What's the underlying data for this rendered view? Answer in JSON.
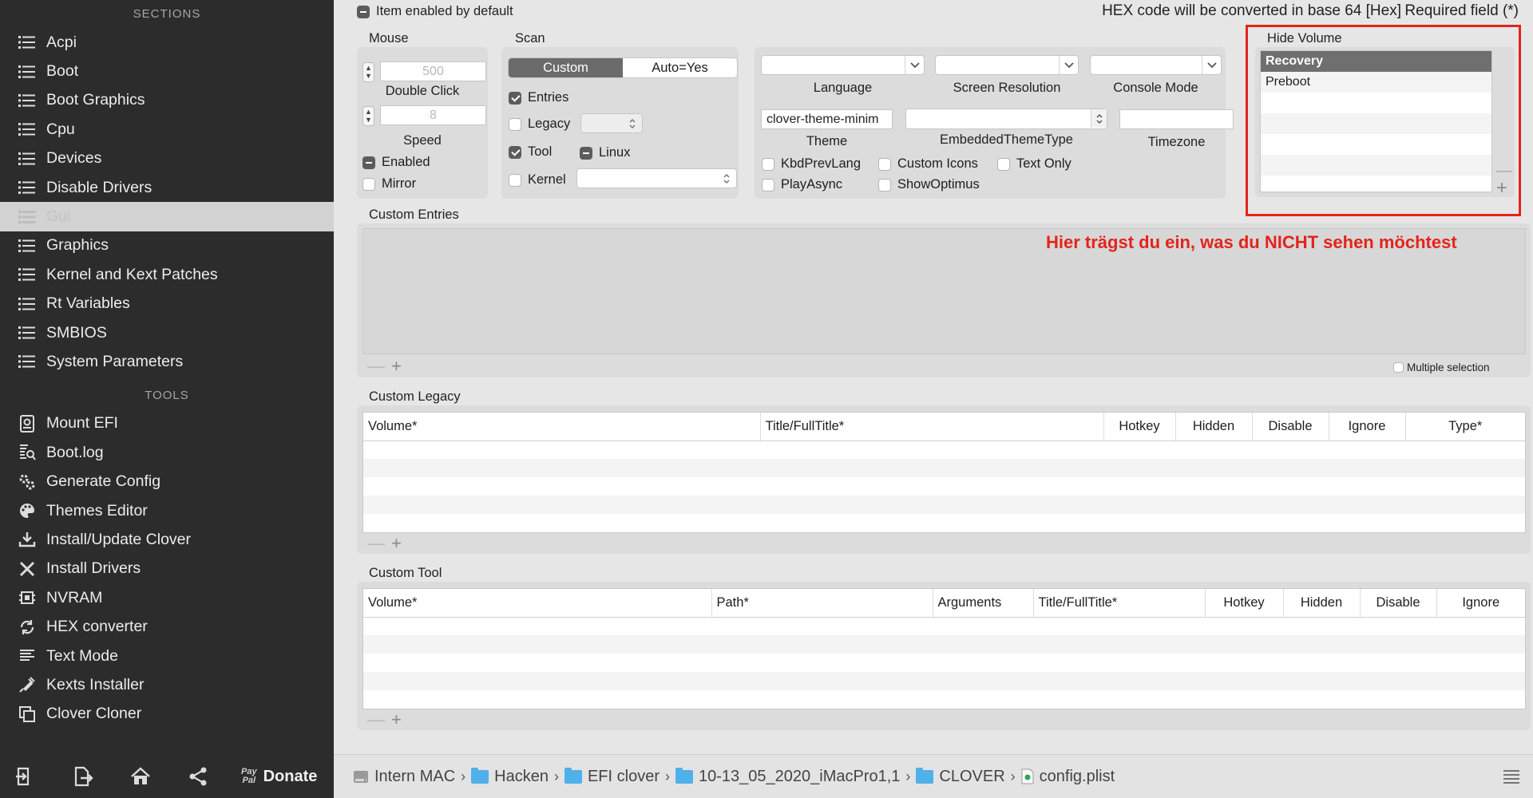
{
  "sidebar": {
    "sections_heading": "SECTIONS",
    "sections": [
      {
        "label": "Acpi"
      },
      {
        "label": "Boot"
      },
      {
        "label": "Boot Graphics"
      },
      {
        "label": "Cpu"
      },
      {
        "label": "Devices"
      },
      {
        "label": "Disable Drivers"
      },
      {
        "label": "Gui",
        "selected": true
      },
      {
        "label": "Graphics"
      },
      {
        "label": "Kernel and Kext Patches"
      },
      {
        "label": "Rt Variables"
      },
      {
        "label": "SMBIOS"
      },
      {
        "label": "System Parameters"
      }
    ],
    "tools_heading": "TOOLS",
    "tools": [
      {
        "label": "Mount EFI",
        "icon": "disk-icon"
      },
      {
        "label": "Boot.log",
        "icon": "log-search-icon"
      },
      {
        "label": "Generate Config",
        "icon": "gears-icon"
      },
      {
        "label": "Themes Editor",
        "icon": "palette-icon"
      },
      {
        "label": "Install/Update Clover",
        "icon": "download-icon"
      },
      {
        "label": "Install Drivers",
        "icon": "tools-icon"
      },
      {
        "label": "NVRAM",
        "icon": "chip-icon"
      },
      {
        "label": "HEX converter",
        "icon": "refresh-icon"
      },
      {
        "label": "Text Mode",
        "icon": "text-lines-icon"
      },
      {
        "label": "Kexts Installer",
        "icon": "plug-icon"
      },
      {
        "label": "Clover Cloner",
        "icon": "copy-icon"
      }
    ],
    "bottom": {
      "donate_label": "Donate",
      "paypal_line1": "Pay",
      "paypal_line2": "Pal"
    }
  },
  "header": {
    "item_enabled_label": "Item enabled by default",
    "hex_note": "HEX code will be converted in base 64 [Hex]",
    "required_note": "Required field (*)"
  },
  "mouse": {
    "title": "Mouse",
    "double_click_value": "500",
    "double_click_label": "Double Click",
    "speed_value": "8",
    "speed_label": "Speed",
    "enabled_label": "Enabled",
    "mirror_label": "Mirror"
  },
  "scan": {
    "title": "Scan",
    "seg_custom": "Custom",
    "seg_auto": "Auto=Yes",
    "entries_label": "Entries",
    "legacy_label": "Legacy",
    "tool_label": "Tool",
    "linux_label": "Linux",
    "kernel_label": "Kernel"
  },
  "appearance": {
    "language_label": "Language",
    "screen_resolution_label": "Screen Resolution",
    "console_mode_label": "Console Mode",
    "theme_value": "clover-theme-minim",
    "theme_label": "Theme",
    "embedded_theme_label": "EmbeddedThemeType",
    "timezone_label": "Timezone",
    "kbdprevlang_label": "KbdPrevLang",
    "custom_icons_label": "Custom Icons",
    "text_only_label": "Text Only",
    "playasync_label": "PlayAsync",
    "showoptimus_label": "ShowOptimus"
  },
  "hide_volume": {
    "title": "Hide Volume",
    "items": [
      "Recovery",
      "Preboot",
      "",
      "",
      "",
      ""
    ],
    "highlight_color": "#e3241c"
  },
  "custom_entries": {
    "title": "Custom Entries",
    "annotation": "Hier trägst du ein, was du NICHT sehen möchtest",
    "multiple_selection_label": "Multiple selection"
  },
  "custom_legacy": {
    "title": "Custom Legacy",
    "columns": [
      "Volume*",
      "Title/FullTitle*",
      "Hotkey",
      "Hidden",
      "Disable",
      "Ignore",
      "Type*"
    ]
  },
  "custom_tool": {
    "title": "Custom Tool",
    "columns": [
      "Volume*",
      "Path*",
      "Arguments",
      "Title/FullTitle*",
      "Hotkey",
      "Hidden",
      "Disable",
      "Ignore"
    ]
  },
  "statusbar": {
    "path": [
      "Intern MAC",
      "Hacken",
      "EFI clover",
      "10-13_05_2020_iMacPro1,1",
      "CLOVER",
      "config.plist"
    ]
  }
}
